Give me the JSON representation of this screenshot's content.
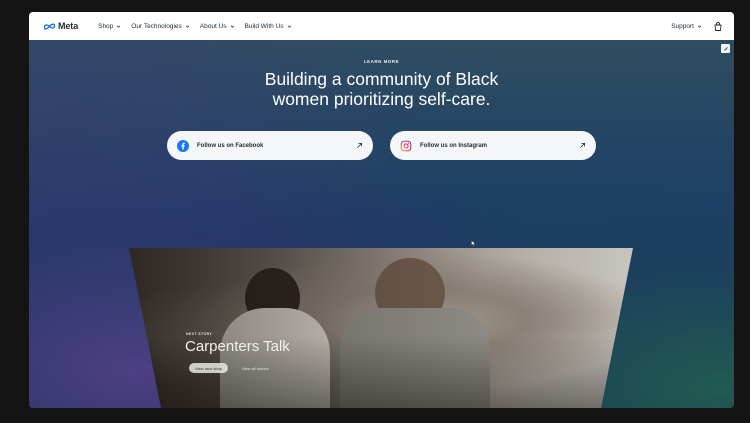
{
  "nav": {
    "brand": "Meta",
    "items": [
      {
        "label": "Shop"
      },
      {
        "label": "Our Technologies"
      },
      {
        "label": "About Us"
      },
      {
        "label": "Build With Us"
      }
    ],
    "support_label": "Support",
    "icons": {
      "logo": "meta-infinity-logo",
      "cart": "shopping-bag-icon",
      "chevron": "chevron-down-icon"
    }
  },
  "hero": {
    "eyebrow": "LEARN MORE",
    "headline_line1": "Building a community of Black",
    "headline_line2": "women prioritizing self-care.",
    "facebook_label": "Follow us on Facebook",
    "instagram_label": "Follow us on Instagram"
  },
  "story": {
    "eyebrow": "NEXT STORY",
    "title": "Carpenters Talk",
    "primary_button": "View next story",
    "secondary_link": "View all stories"
  },
  "colors": {
    "facebook": "#1877f2",
    "text_dark": "#1c2b33",
    "hero_bg": "#1d3f66"
  }
}
